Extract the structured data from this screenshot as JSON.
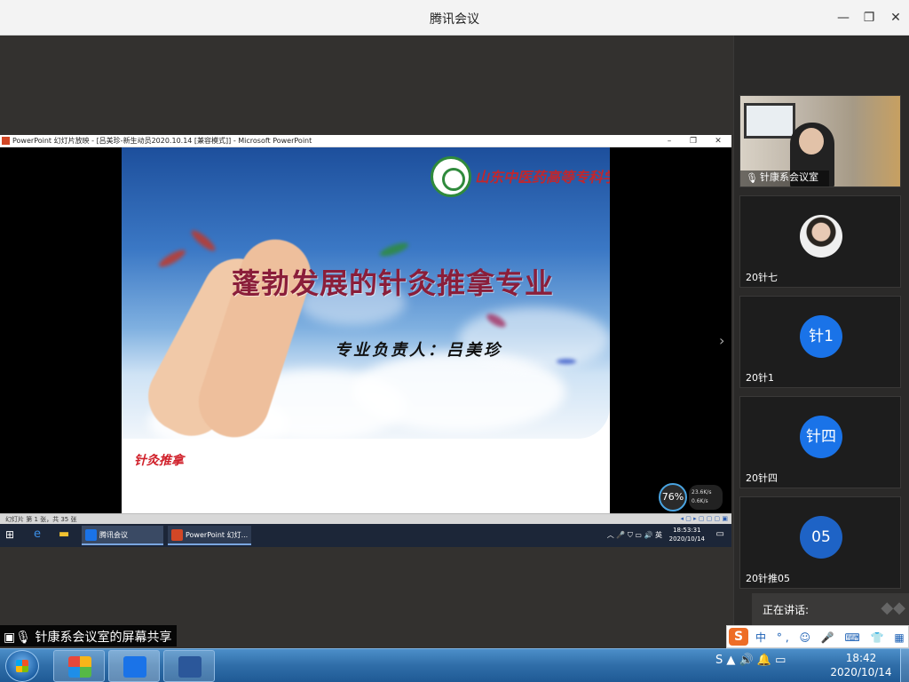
{
  "window": {
    "title": "腾讯会议",
    "controls": {
      "minimize": "—",
      "restore": "❐",
      "close": "✕"
    }
  },
  "powerpoint": {
    "title": "PowerPoint 幻灯片放映 - [吕美珍-新生动员2020.10.14 [兼容模式]] - Microsoft PowerPoint",
    "controls": {
      "minimize": "–",
      "restore": "❐",
      "close": "✕"
    },
    "status": "幻灯片 第 1 张，共 35 张",
    "status_icons": "◂ ▢ ▸ ▢ ▢ ▢ ▣"
  },
  "slide": {
    "school": "山东中医药高等专科学校",
    "title": "蓬勃发展的针灸推拿专业",
    "subtitle": "专业负责人：吕美珍",
    "footer": "针灸推拿"
  },
  "performance": {
    "percent": "76%",
    "up": "23.6K/s",
    "down": "0.6K/s"
  },
  "inner_taskbar": {
    "apps": [
      {
        "label": "腾讯会议"
      },
      {
        "label": "PowerPoint 幻灯..."
      }
    ],
    "tray": "︿ 🎤 ⛉ ▭ 🔊 英",
    "time": "18:53:31",
    "date": "2020/10/14"
  },
  "participants": [
    {
      "name": "针康系会议室",
      "type": "video"
    },
    {
      "name": "20针七",
      "type": "photo"
    },
    {
      "name": "20针1",
      "avatar_text": "针1",
      "type": "text"
    },
    {
      "name": "20针四",
      "avatar_text": "针四",
      "type": "text"
    },
    {
      "name": "20针推05",
      "avatar_text": "05",
      "type": "text"
    }
  ],
  "speaking_label": "正在讲话:",
  "share_label": "针康系会议室的屏幕共享",
  "ime": {
    "logo": "S",
    "items": "中 °, ☺ 🎤 ⌨ 👕 ▦"
  },
  "taskbar": {
    "tray": "S  ▲  🔊  🔔  ▭",
    "time": "18:42",
    "date": "2020/10/14"
  },
  "colors": {
    "accent": "#1a73e8",
    "slide_title": "#8a1e3a",
    "footer": "#d0202a"
  }
}
